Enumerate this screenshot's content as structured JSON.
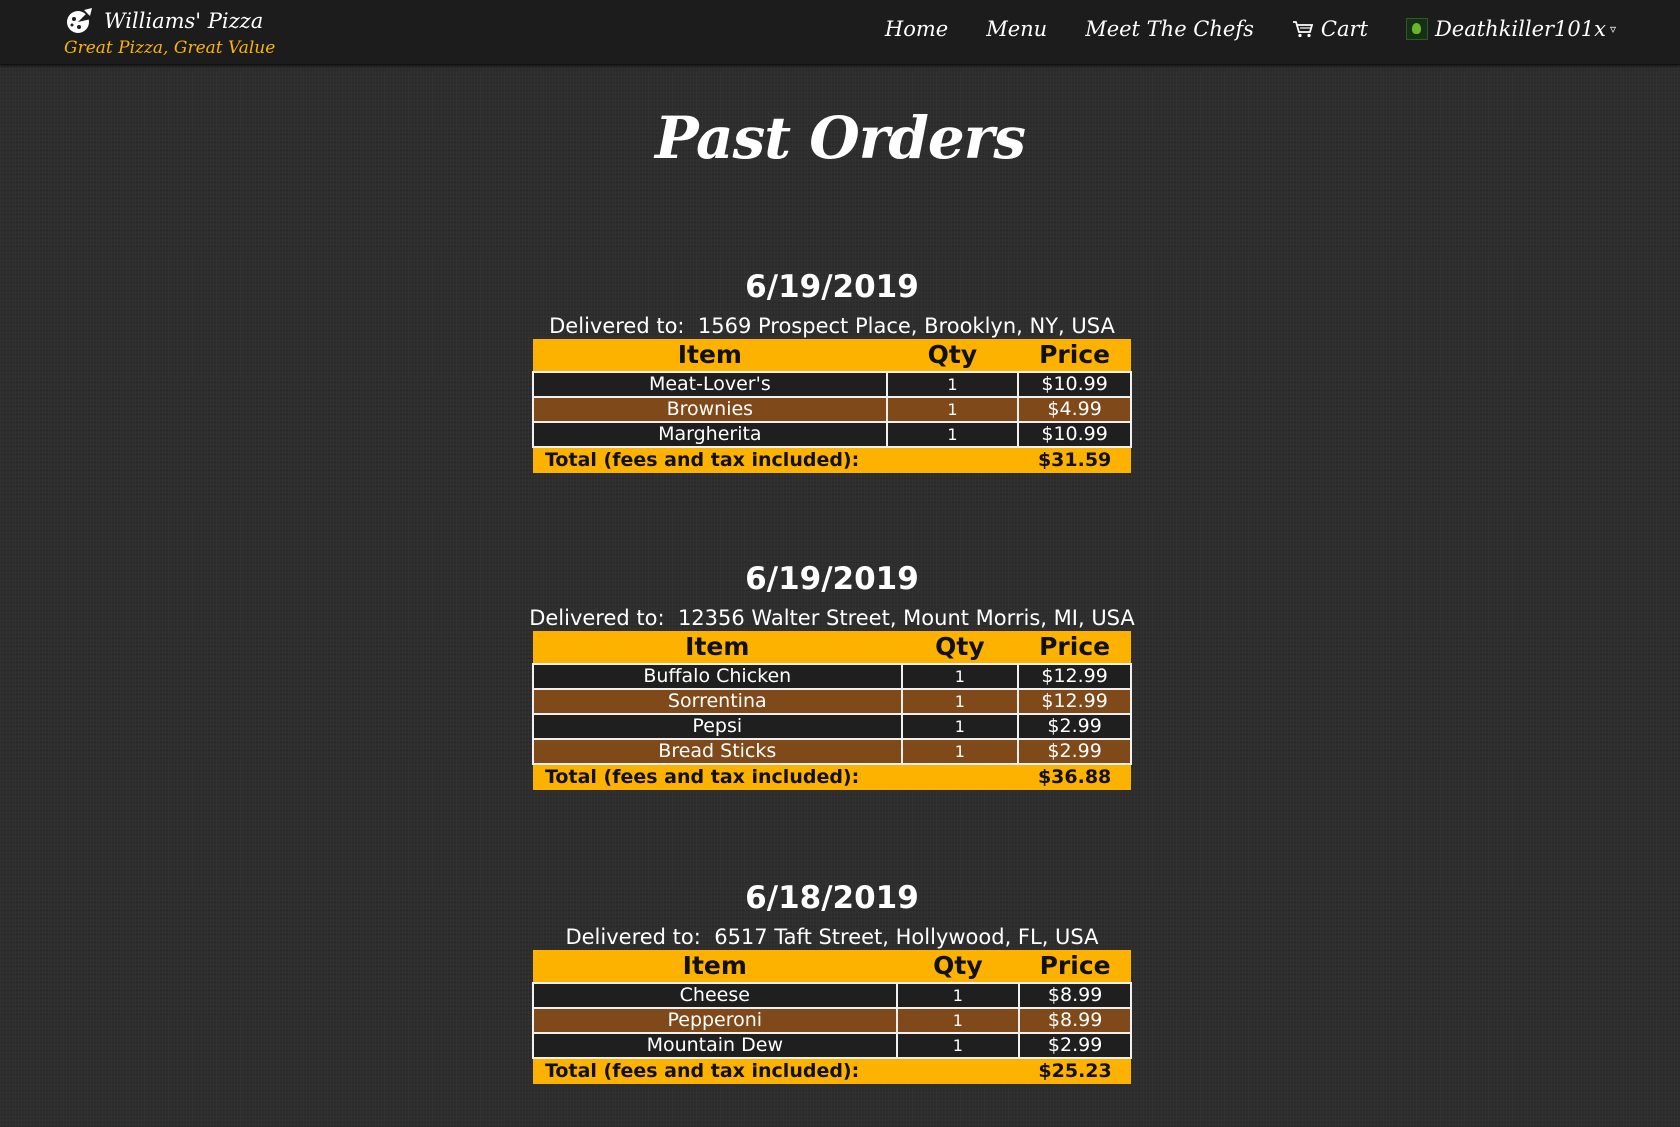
{
  "navbar": {
    "brand_name": "Williams' Pizza",
    "brand_tagline": "Great Pizza, Great Value",
    "links": {
      "home": "Home",
      "menu": "Menu",
      "chefs": "Meet The Chefs",
      "cart": "Cart"
    },
    "user": {
      "name": "Deathkiller101x",
      "caret": "▿"
    }
  },
  "page_title": "Past Orders",
  "delivered_label": "Delivered to:",
  "table_headers": {
    "item": "Item",
    "qty": "Qty",
    "price": "Price"
  },
  "total_label": "Total (fees and tax included):",
  "orders": [
    {
      "date": "6/19/2019",
      "address": "1569 Prospect Place, Brooklyn, NY, USA",
      "items": [
        {
          "name": "Meat-Lover's",
          "qty": "1",
          "price": "$10.99"
        },
        {
          "name": "Brownies",
          "qty": "1",
          "price": "$4.99"
        },
        {
          "name": "Margherita",
          "qty": "1",
          "price": "$10.99"
        }
      ],
      "total": "$31.59"
    },
    {
      "date": "6/19/2019",
      "address": "12356 Walter Street, Mount Morris, MI, USA",
      "items": [
        {
          "name": "Buffalo Chicken",
          "qty": "1",
          "price": "$12.99"
        },
        {
          "name": "Sorrentina",
          "qty": "1",
          "price": "$12.99"
        },
        {
          "name": "Pepsi",
          "qty": "1",
          "price": "$2.99"
        },
        {
          "name": "Bread Sticks",
          "qty": "1",
          "price": "$2.99"
        }
      ],
      "total": "$36.88"
    },
    {
      "date": "6/18/2019",
      "address": "6517 Taft Street, Hollywood, FL, USA",
      "items": [
        {
          "name": "Cheese",
          "qty": "1",
          "price": "$8.99"
        },
        {
          "name": "Pepperoni",
          "qty": "1",
          "price": "$8.99"
        },
        {
          "name": "Mountain Dew",
          "qty": "1",
          "price": "$2.99"
        }
      ],
      "total": "$25.23"
    }
  ],
  "colors": {
    "accent": "#fdb200",
    "tagline": "#fab308",
    "row_alt": "#80491a",
    "background": "#2e2e2e"
  }
}
